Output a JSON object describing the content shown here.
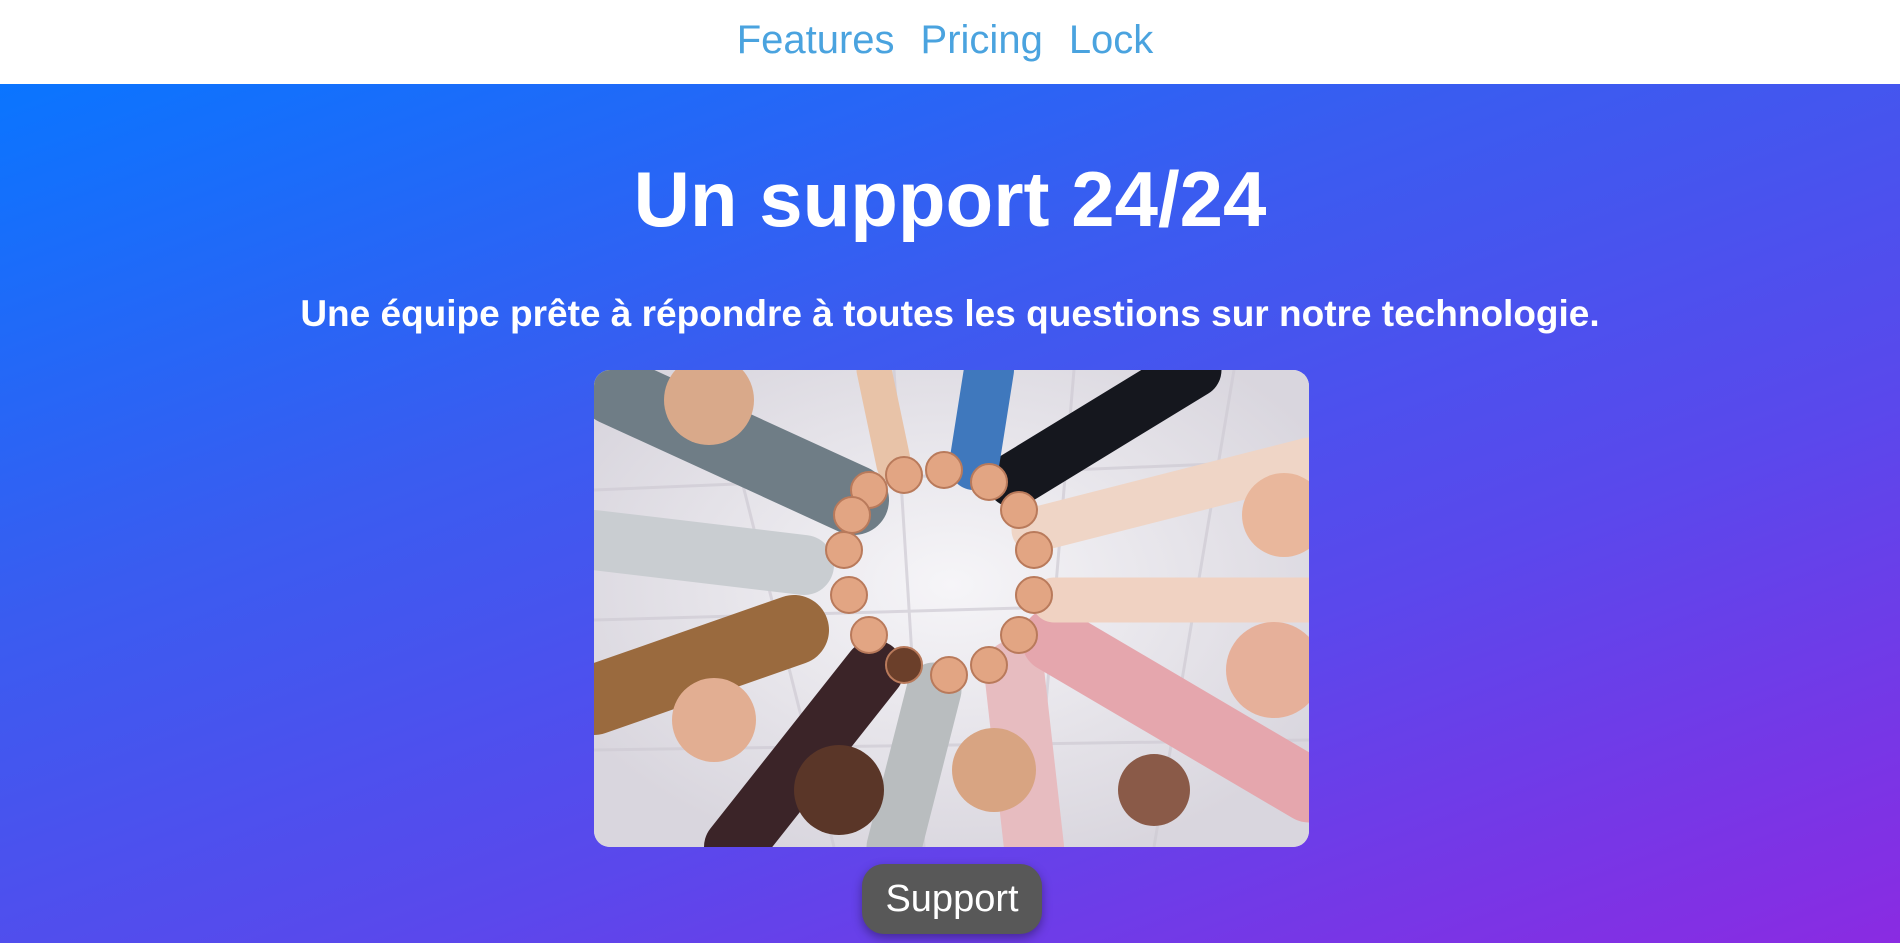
{
  "nav": {
    "items": [
      {
        "label": "Features"
      },
      {
        "label": "Pricing"
      },
      {
        "label": "Lock"
      }
    ]
  },
  "hero": {
    "title": "Un support 24/24",
    "subtitle": "Une équipe prête à répondre à toutes les questions sur notre technologie.",
    "image": {
      "subject": "team-hands-circle-photo"
    },
    "button_label": "Support"
  },
  "colors": {
    "nav_link": "#4aa3df",
    "gradient_start": "#0a75ff",
    "gradient_end": "#8a2be2",
    "button_bg": "#585858",
    "text": "#ffffff"
  }
}
